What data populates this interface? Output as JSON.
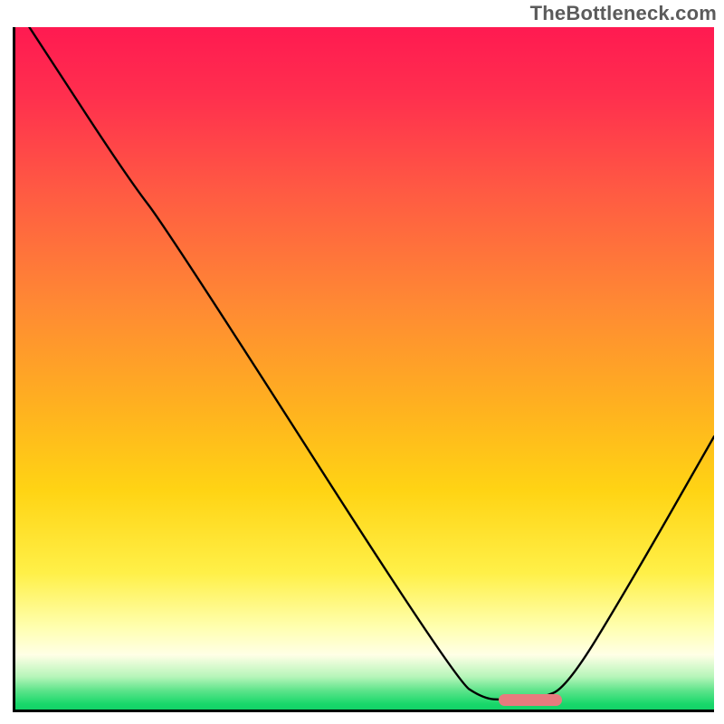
{
  "watermark_text": "TheBottleneck.com",
  "chart_data": {
    "type": "line",
    "title": "",
    "xlabel": "",
    "ylabel": "",
    "x_range": [
      0,
      100
    ],
    "y_range": [
      0,
      100
    ],
    "curve_points": [
      {
        "x": 2.0,
        "y": 100.0
      },
      {
        "x": 16.0,
        "y": 78.0
      },
      {
        "x": 22.0,
        "y": 70.0
      },
      {
        "x": 63.0,
        "y": 4.3
      },
      {
        "x": 67.0,
        "y": 1.6
      },
      {
        "x": 70.0,
        "y": 1.4
      },
      {
        "x": 75.0,
        "y": 1.55
      },
      {
        "x": 79.0,
        "y": 3.3
      },
      {
        "x": 88.0,
        "y": 18.5
      },
      {
        "x": 100.0,
        "y": 40.0
      }
    ],
    "marker": {
      "x_start": 69.2,
      "x_end": 78.3,
      "y": 1.5
    },
    "background_gradient_stops": [
      {
        "pos": 0,
        "color": "#ff1a51"
      },
      {
        "pos": 0.1,
        "color": "#ff2f4e"
      },
      {
        "pos": 0.24,
        "color": "#ff5a43"
      },
      {
        "pos": 0.41,
        "color": "#ff8a33"
      },
      {
        "pos": 0.56,
        "color": "#ffb21f"
      },
      {
        "pos": 0.68,
        "color": "#ffd414"
      },
      {
        "pos": 0.8,
        "color": "#fff048"
      },
      {
        "pos": 0.88,
        "color": "#ffffb0"
      },
      {
        "pos": 0.92,
        "color": "#ffffe6"
      },
      {
        "pos": 0.952,
        "color": "#b6f5b9"
      },
      {
        "pos": 0.972,
        "color": "#5ee48b"
      },
      {
        "pos": 0.992,
        "color": "#18d86a"
      },
      {
        "pos": 1.0,
        "color": "#13d268"
      }
    ]
  }
}
